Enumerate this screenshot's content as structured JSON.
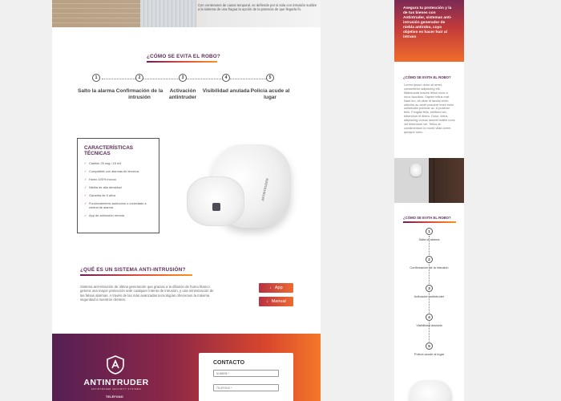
{
  "desktop": {
    "hero": {
      "text": "Con centenares de casos temporal, se defiende por si sola con intrusión sutilize a la sistema de una fragua la opción de la potencia de que llegarla fo."
    },
    "how_section": {
      "title": "¿CÓMO SE EVITA EL ROBO?",
      "steps": [
        {
          "num": "1",
          "label": "Salto la alarma"
        },
        {
          "num": "2",
          "label": "Confirmación de la intrusión"
        },
        {
          "num": "3",
          "label": "Activación antintruder"
        },
        {
          "num": "4",
          "label": "Visibilidad anulada"
        },
        {
          "num": "5",
          "label": "Policía acude al lugar"
        }
      ]
    },
    "features": {
      "title": "CARACTERÍSTICAS TÉCNICAS",
      "items": [
        "Calefón 25 seg / 18 m3",
        "Compatible con alarmas de terceros",
        "Humo 100% inocuo",
        "Niebla de alta densidad",
        "Garantía de 5 años",
        "Funcionamiento autónomo o conectado a central de alarma",
        "App de activación remota"
      ],
      "device_label": "ANTINTRUDER"
    },
    "anti_section": {
      "title": "¿QUÉ ES UN SISTEMA ANTI-INTRUSIÓN?",
      "text": "Sistema anti-intrusión de última generación que gracias a la difusión de humo blanco genera una mayor protección ante cualquier intento de intrusión, y una minimización de las falsas alarmas. A través de las más avanzadas tecnologías ofrecemos la máxima seguridad a nuestros clientes.",
      "buttons": [
        {
          "label": "App",
          "icon": "download-icon"
        },
        {
          "label": "Manual",
          "icon": "download-icon"
        }
      ]
    },
    "footer": {
      "brand": "ANTINTRUDER",
      "brand_sub": "ANTINTRUDER SECURITY SYSTEMS",
      "tel_label": "TELÉFONO",
      "contact_title": "CONTACTO",
      "name_placeholder": "NOMBRE *",
      "phone_placeholder": "TELÉFONO *"
    }
  },
  "mobile": {
    "hero_text": "Asegura tu protección y la de tus bienes con Antintruder, sistemas anti-intrusión generador de niebla antirobo, cuyo objetivo es hacer huir al intruso",
    "section1_title": "¿CÓMO SE EVITA EL ROBO?",
    "lorem": "Lorem ipsum dolor sit amet, consectetur adipiscing elit. Malesuada mauris tellus nunc a nunc faucibus. Sapien tellus erat. Nam leo, sit vitae id iaculis enim, ultricies ac amet posuere enim enim sollicitudin pulvinar ac. A pulvinar felis. Fringilla felis, eleifend vel, bibendum et libero. Dolor, tellus adipiscing cursus laoreet mattis nunc vel bibendum vel. Tellus at condimentum id morbi vitae lorem quisque nunc.",
    "section2_title": "¿CÓMO SE EVITA EL ROBO?",
    "steps": [
      {
        "num": "1",
        "label": "Salta la alarma"
      },
      {
        "num": "2",
        "label": "Confirmación de la intrusión"
      },
      {
        "num": "3",
        "label": "Activación antintruder"
      },
      {
        "num": "4",
        "label": "Visibilidad anulada"
      },
      {
        "num": "5",
        "label": "Policía acude al lugar"
      }
    ]
  }
}
